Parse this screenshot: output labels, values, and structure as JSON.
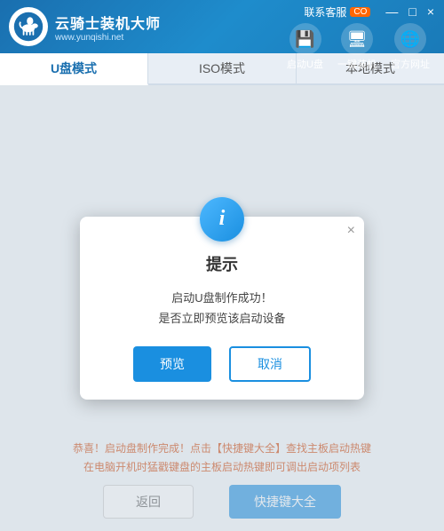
{
  "titlebar": {
    "logo_title": "云骑士装机大师",
    "logo_subtitle": "www.yunqishi.net",
    "kefu_label": "联系客服",
    "kefu_badge": "CO",
    "window_minimize": "—",
    "window_restore": "□",
    "window_close": "×"
  },
  "nav": {
    "items": [
      {
        "id": "udisk",
        "icon": "💾",
        "label": "启动U盘"
      },
      {
        "id": "install",
        "icon": "🖥",
        "label": "一键装机"
      },
      {
        "id": "website",
        "icon": "🌐",
        "label": "官方网址"
      }
    ]
  },
  "tabs": [
    {
      "id": "udisk-mode",
      "label": "U盘模式",
      "active": true
    },
    {
      "id": "iso-mode",
      "label": "ISO模式",
      "active": false
    },
    {
      "id": "local-mode",
      "label": "本地模式",
      "active": false
    }
  ],
  "dialog": {
    "icon": "i",
    "title": "提示",
    "message_line1": "启动U盘制作成功！",
    "message_line2": "是否立即预览该启动设备",
    "btn_preview": "预览",
    "btn_cancel": "取消",
    "close_btn": "×"
  },
  "info": {
    "line1": "恭喜！启动盘制作完成！点击【快捷键大全】查找主板启动热键",
    "line2": "在电脑开机时猛戳键盘的主板启动热键即可调出启动项列表"
  },
  "bottom_buttons": {
    "return_label": "返回",
    "shortcut_label": "快捷键大全"
  }
}
